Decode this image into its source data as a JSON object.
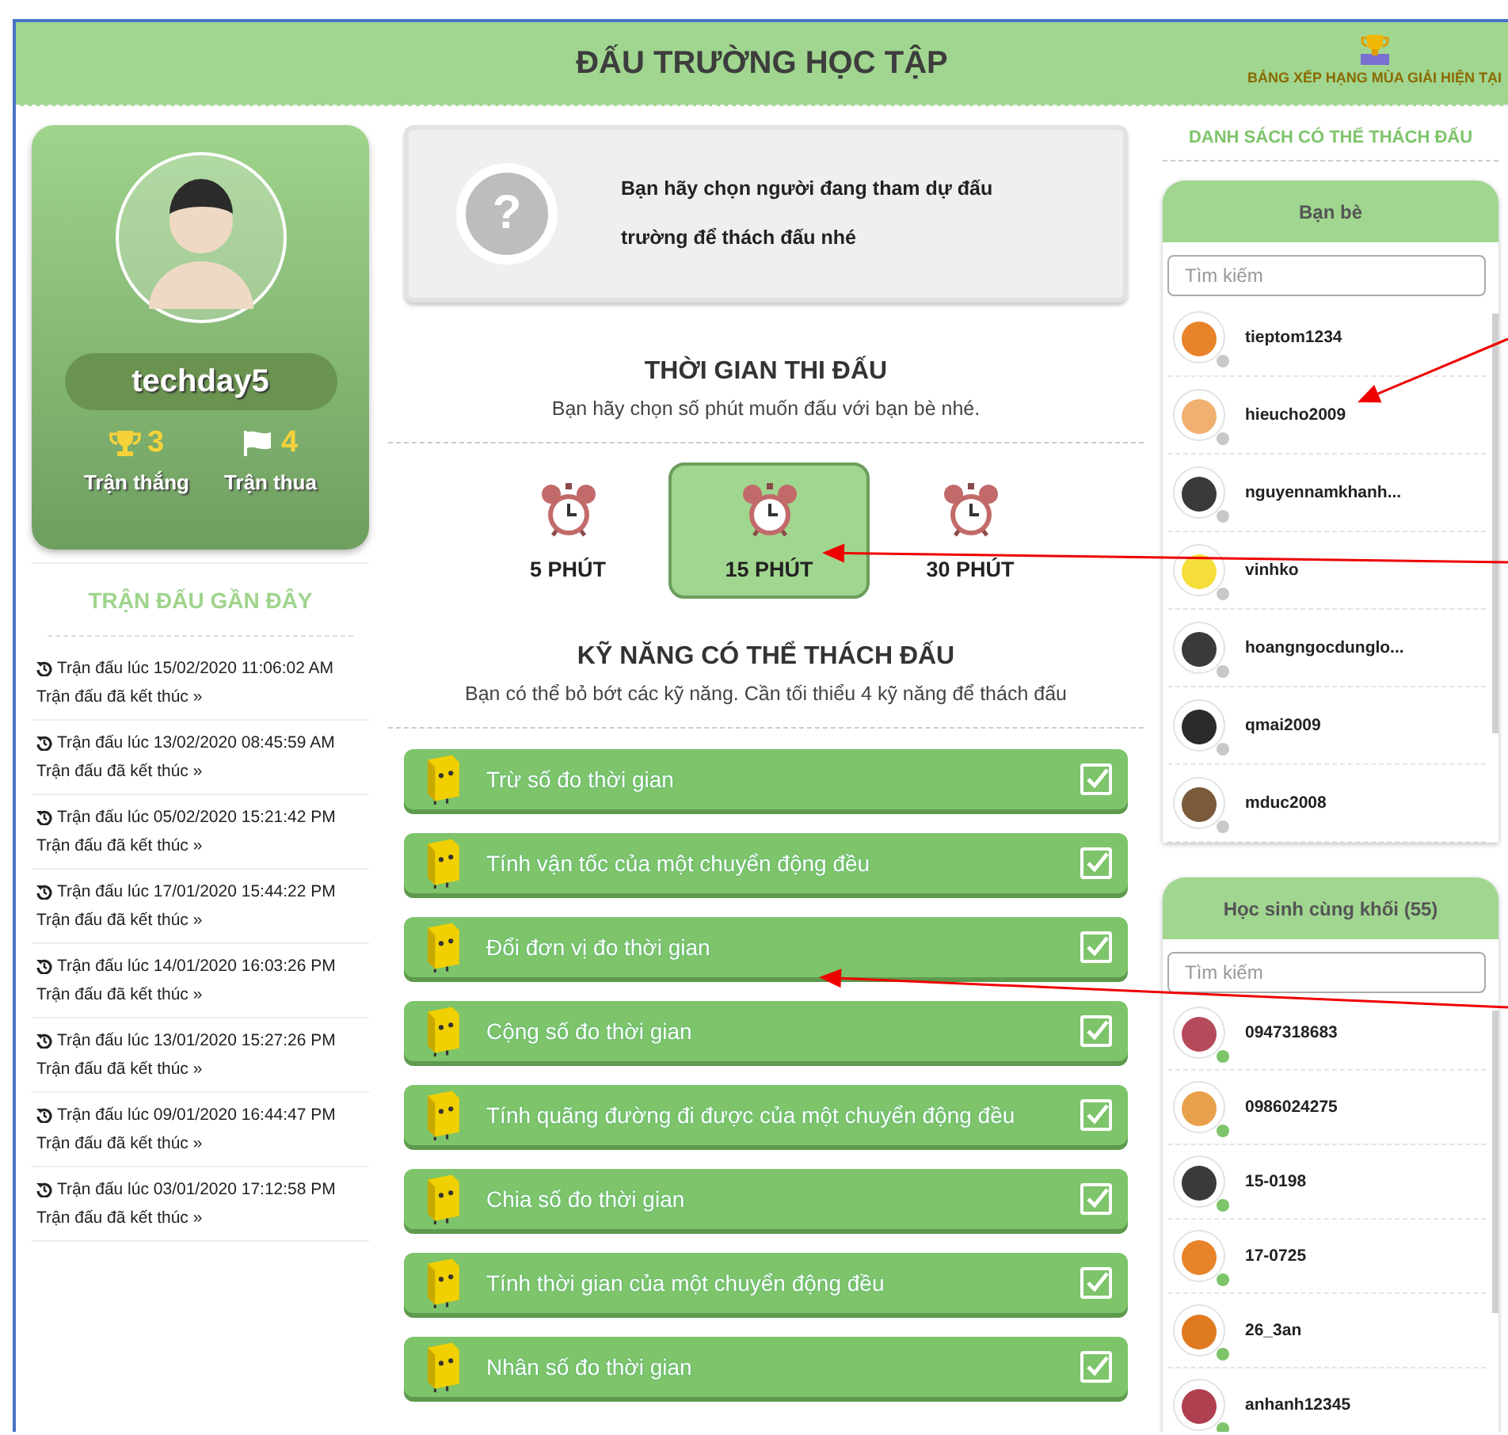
{
  "header": {
    "title": "ĐẤU TRƯỜNG HỌC TẬP",
    "leaderboard_link": "BẢNG XẾP HẠNG MÙA GIẢI HIỆN TẠI"
  },
  "profile": {
    "username": "techday5",
    "wins": "3",
    "wins_label": "Trận thắng",
    "losses": "4",
    "losses_label": "Trận thua"
  },
  "recent": {
    "title": "TRẬN ĐẤU GẦN ĐÂY",
    "matches": [
      {
        "time": "Trận đấu lúc 15/02/2020 11:06:02 AM",
        "status": "Trận đấu đã kết thúc »"
      },
      {
        "time": "Trận đấu lúc 13/02/2020 08:45:59 AM",
        "status": "Trận đấu đã kết thúc »"
      },
      {
        "time": "Trận đấu lúc 05/02/2020 15:21:42 PM",
        "status": "Trận đấu đã kết thúc »"
      },
      {
        "time": "Trận đấu lúc 17/01/2020 15:44:22 PM",
        "status": "Trận đấu đã kết thúc »"
      },
      {
        "time": "Trận đấu lúc 14/01/2020 16:03:26 PM",
        "status": "Trận đấu đã kết thúc »"
      },
      {
        "time": "Trận đấu lúc 13/01/2020 15:27:26 PM",
        "status": "Trận đấu đã kết thúc »"
      },
      {
        "time": "Trận đấu lúc 09/01/2020 16:44:47 PM",
        "status": "Trận đấu đã kết thúc »"
      },
      {
        "time": "Trận đấu lúc 03/01/2020 17:12:58 PM",
        "status": "Trận đấu đã kết thúc »"
      }
    ]
  },
  "opponent_prompt": {
    "icon": "?",
    "message": "Bạn hãy chọn người đang tham dự đấu trường để thách đấu nhé"
  },
  "duration": {
    "title": "THỜI GIAN THI ĐẤU",
    "subtitle": "Bạn hãy chọn số phút muốn đấu với bạn bè nhé.",
    "options": [
      {
        "label": "5 PHÚT",
        "selected": false
      },
      {
        "label": "15 PHÚT",
        "selected": true
      },
      {
        "label": "30 PHÚT",
        "selected": false
      }
    ]
  },
  "skills": {
    "title": "KỸ NĂNG CÓ THỂ THÁCH ĐẤU",
    "subtitle": "Bạn có thể bỏ bớt các kỹ năng. Cần tối thiểu 4 kỹ năng để thách đấu",
    "items": [
      {
        "name": "Trừ số đo thời gian",
        "checked": true
      },
      {
        "name": "Tính vận tốc của một chuyển động đều",
        "checked": true
      },
      {
        "name": "Đổi đơn vị đo thời gian",
        "checked": true
      },
      {
        "name": "Cộng số đo thời gian",
        "checked": true
      },
      {
        "name": "Tính quãng đường đi được của một chuyển động đều",
        "checked": true
      },
      {
        "name": "Chia số đo thời gian",
        "checked": true
      },
      {
        "name": "Tính thời gian của một chuyển động đều",
        "checked": true
      },
      {
        "name": "Nhân số đo thời gian",
        "checked": true
      }
    ]
  },
  "challenge_list": {
    "title": "DANH SÁCH CÓ THỂ THÁCH ĐẤU",
    "panels": [
      {
        "title": "Bạn bè",
        "placeholder": "Tìm kiếm",
        "users": [
          {
            "name": "tieptom1234",
            "online": false
          },
          {
            "name": "hieucho2009",
            "online": false
          },
          {
            "name": "nguyennamkhanh...",
            "online": false
          },
          {
            "name": "vinhko",
            "online": false
          },
          {
            "name": "hoangngocdunglo...",
            "online": false
          },
          {
            "name": "qmai2009",
            "online": false
          },
          {
            "name": "mduc2008",
            "online": false
          }
        ]
      },
      {
        "title": "Học sinh cùng khối (55)",
        "placeholder": "Tìm kiếm",
        "users": [
          {
            "name": "0947318683",
            "online": true
          },
          {
            "name": "0986024275",
            "online": true
          },
          {
            "name": "15-0198",
            "online": true
          },
          {
            "name": "17-0725",
            "online": true
          },
          {
            "name": "26_3an",
            "online": true
          },
          {
            "name": "anhanh12345",
            "online": true
          }
        ]
      }
    ]
  }
}
